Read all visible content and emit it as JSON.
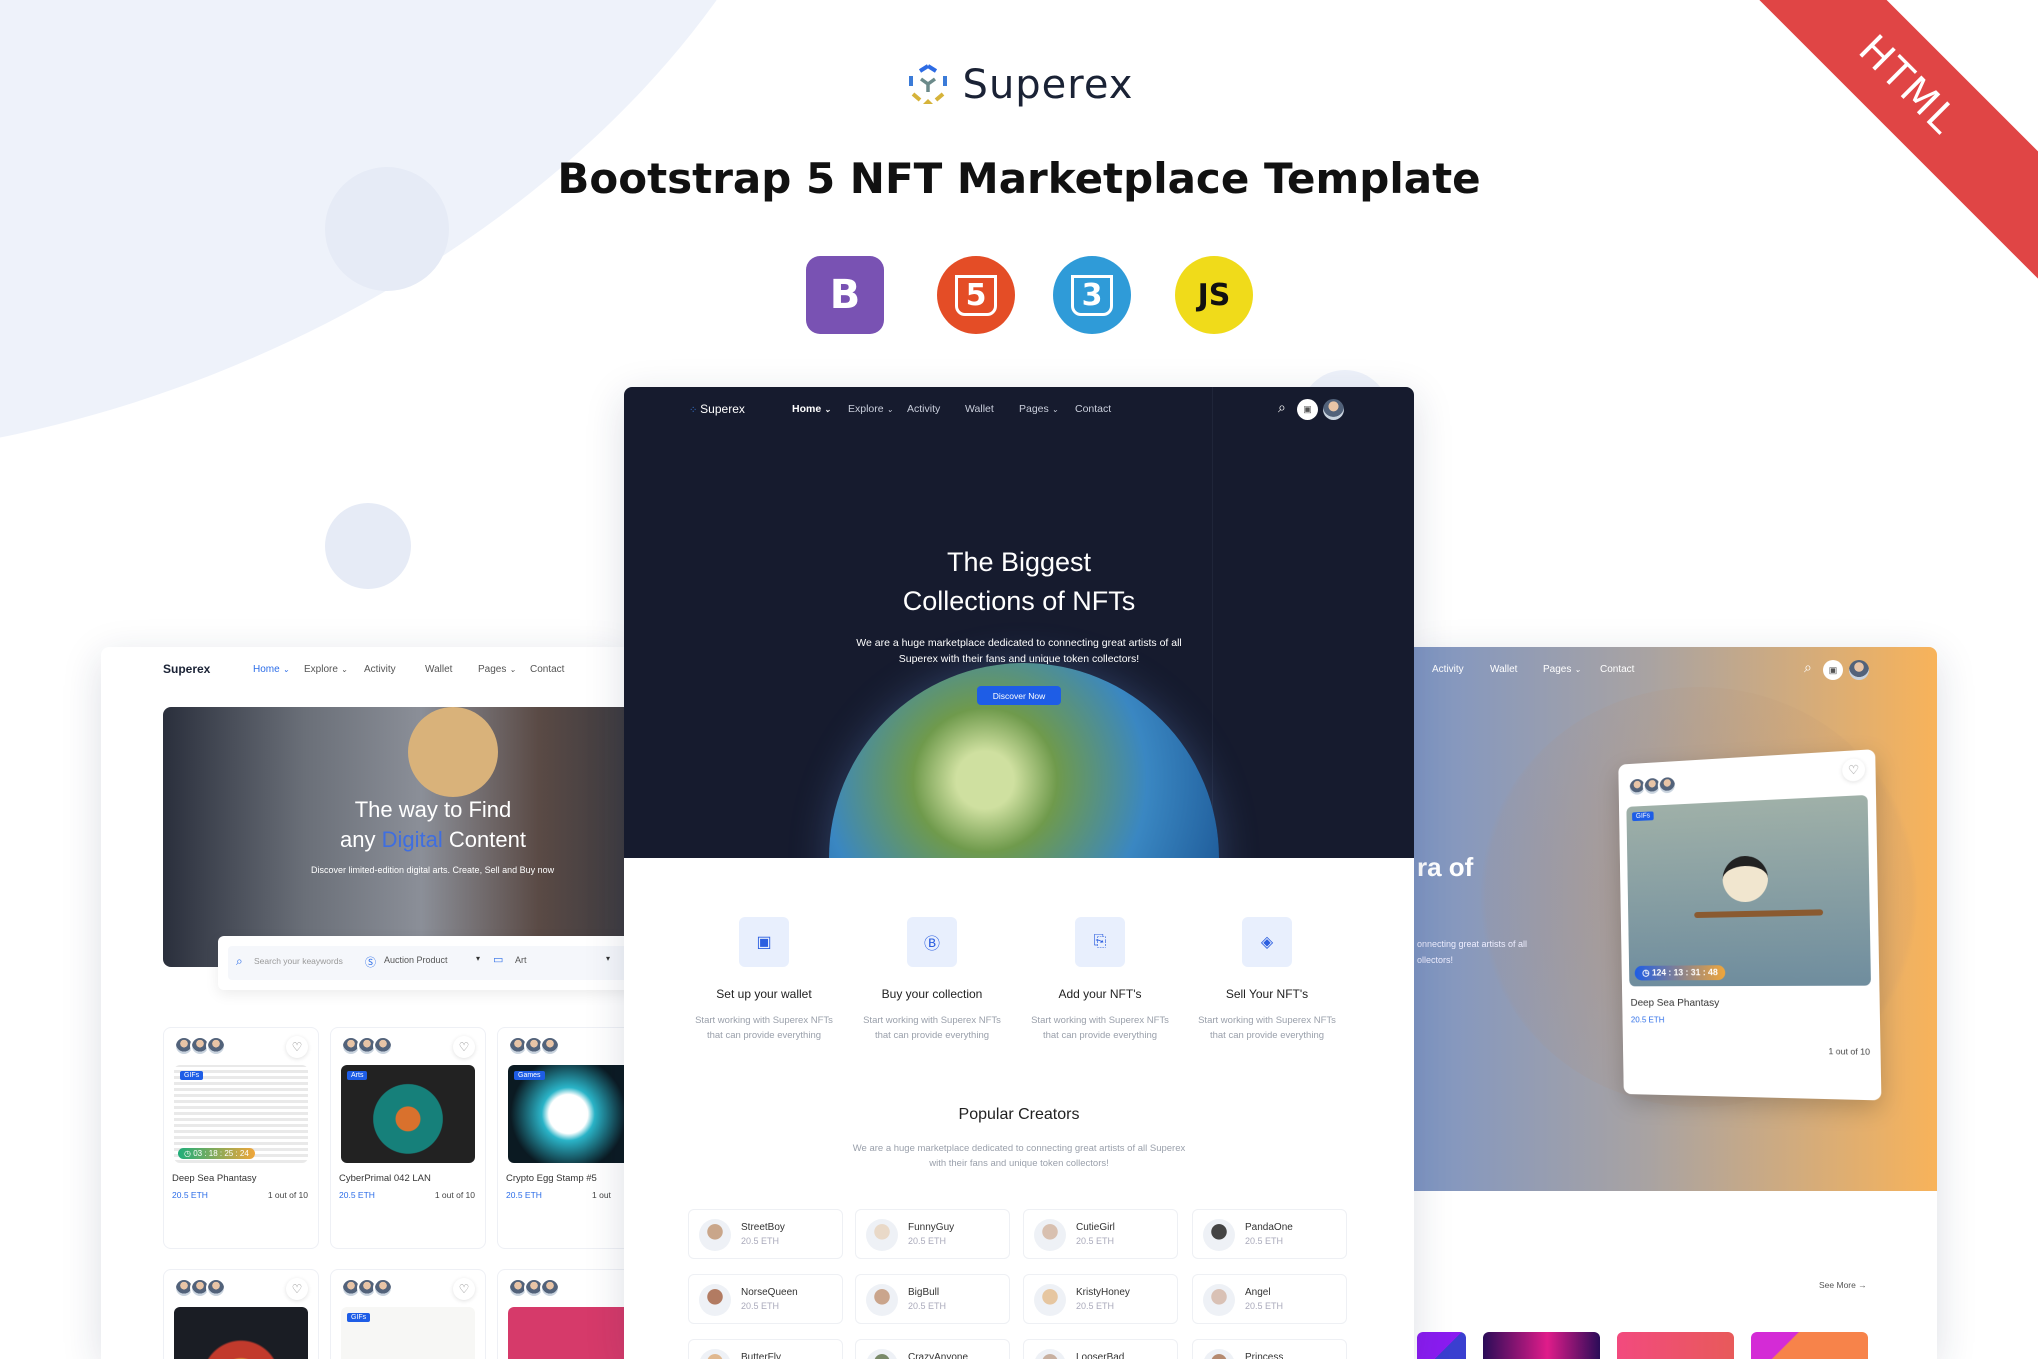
{
  "banner": {
    "brand": "Superex",
    "headline": "Bootstrap 5 NFT Marketplace Template",
    "ribbon": "HTML",
    "tech_icons": [
      {
        "name": "bootstrap",
        "label": "B",
        "color": "#7952b3"
      },
      {
        "name": "html5",
        "label": "5",
        "color": "#e44d26"
      },
      {
        "name": "css3",
        "label": "3",
        "color": "#2f9bd8"
      },
      {
        "name": "javascript",
        "label": "JS",
        "color": "#f0db1a"
      }
    ]
  },
  "nav": {
    "brand": "Superex",
    "items": [
      "Home",
      "Explore",
      "Activity",
      "Wallet",
      "Pages",
      "Contact"
    ],
    "active": "Home"
  },
  "center": {
    "hero_line1": "The Biggest",
    "hero_line2": "Collections of NFTs",
    "hero_desc1": "We are a huge marketplace dedicated to connecting great artists of all",
    "hero_desc2": "Superex with their fans and unique token collectors!",
    "cta": "Discover Now",
    "steps": [
      {
        "icon": "wallet-icon",
        "title": "Set up your wallet",
        "desc1": "Start working with Superex NFTs",
        "desc2": "that can provide everything"
      },
      {
        "icon": "bitcoin-icon",
        "title": "Buy your collection",
        "desc1": "Start working with Superex NFTs",
        "desc2": "that can provide everything"
      },
      {
        "icon": "add-wallet-icon",
        "title": "Add your NFT's",
        "desc1": "Start working with Superex NFTs",
        "desc2": "that can provide everything"
      },
      {
        "icon": "layers-icon",
        "title": "Sell Your NFT's",
        "desc1": "Start working with Superex NFTs",
        "desc2": "that can provide everything"
      }
    ],
    "creators_title": "Popular Creators",
    "creators_desc1": "We are a huge marketplace dedicated to connecting great artists of all Superex",
    "creators_desc2": "with their fans and unique token collectors!",
    "creators": [
      {
        "name": "StreetBoy",
        "eth": "20.5 ETH"
      },
      {
        "name": "FunnyGuy",
        "eth": "20.5 ETH"
      },
      {
        "name": "CutieGirl",
        "eth": "20.5 ETH"
      },
      {
        "name": "PandaOne",
        "eth": "20.5 ETH"
      },
      {
        "name": "NorseQueen",
        "eth": "20.5 ETH"
      },
      {
        "name": "BigBull",
        "eth": "20.5 ETH"
      },
      {
        "name": "KristyHoney",
        "eth": "20.5 ETH"
      },
      {
        "name": "Angel",
        "eth": "20.5 ETH"
      },
      {
        "name": "ButterFly",
        "eth": ""
      },
      {
        "name": "CrazyAnyone",
        "eth": ""
      },
      {
        "name": "LooserBad",
        "eth": ""
      },
      {
        "name": "Princess",
        "eth": ""
      }
    ]
  },
  "left": {
    "hero_line1": "The way to Find",
    "hero_any": "any",
    "hero_digital": "Digital",
    "hero_content": "Content",
    "hero_desc": "Discover limited-edition digital arts. Create, Sell and Buy now",
    "search_placeholder": "Search your keaywords",
    "filter1": "Auction Product",
    "filter2": "Art",
    "cards": [
      {
        "tag": "GIFs",
        "timer": "03 : 18 : 25 : 24",
        "title": "Deep Sea Phantasy",
        "price": "20.5 ETH",
        "edition": "1 out of 10"
      },
      {
        "tag": "Arts",
        "timer": "",
        "title": "CyberPrimal 042 LAN",
        "price": "20.5 ETH",
        "edition": "1 out of 10"
      },
      {
        "tag": "Games",
        "timer": "",
        "title": "Crypto Egg Stamp #5",
        "price": "20.5 ETH",
        "edition": "1 out"
      }
    ],
    "cards_row2": [
      {
        "tag": ""
      },
      {
        "tag": "GIFs"
      },
      {
        "tag": ""
      }
    ]
  },
  "right": {
    "hero_fragment": "ra of",
    "desc1": "onnecting great artists of all",
    "desc2": "ollectors!",
    "card": {
      "tag": "GIFs",
      "timer": "124 : 13 : 31 : 48",
      "title": "Deep Sea Phantasy",
      "price": "20.5 ETH",
      "edition": "1 out of 10"
    },
    "see_more": "See More →"
  }
}
